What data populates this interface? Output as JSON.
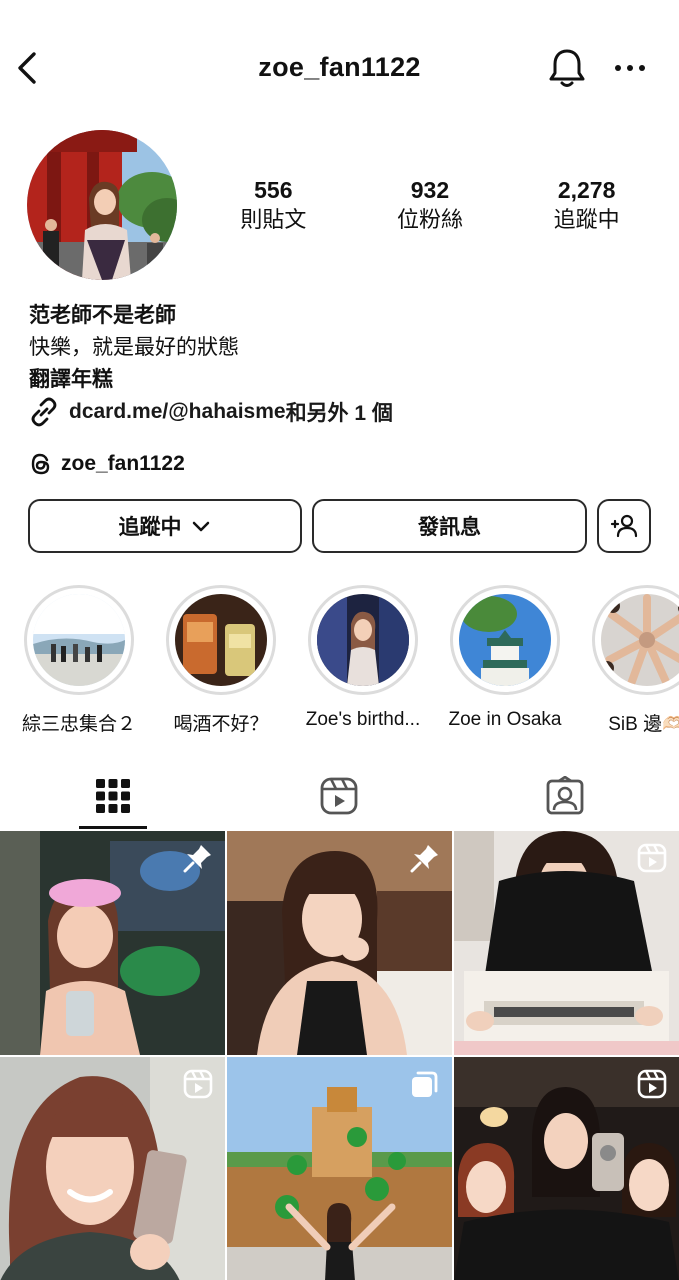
{
  "profile": {
    "username": "zoe_fan1122",
    "stats": [
      {
        "value": "556",
        "label": "則貼文"
      },
      {
        "value": "932",
        "label": "位粉絲"
      },
      {
        "value": "2,278",
        "label": "追蹤中"
      }
    ],
    "bio": {
      "name": "范老師不是老師",
      "line1": "快樂，就是最好的狀態",
      "line2": "翻譯年糕",
      "link_text": "dcard.me/@hahaisme",
      "link_suffix": "和另外 1 個",
      "threads_handle": "zoe_fan1122"
    }
  },
  "actions": {
    "follow_label": "追蹤中",
    "message_label": "發訊息"
  },
  "highlights": [
    {
      "label": "綜三忠集合２"
    },
    {
      "label": "喝酒不好？"
    },
    {
      "label": "Zoe's birthd..."
    },
    {
      "label": "Zoe in Osaka"
    },
    {
      "label": "SiB 邊🫶🏻"
    }
  ],
  "tabs": [
    "posts-grid",
    "reels",
    "tagged"
  ],
  "grid": [
    {
      "badge": "pin-icon"
    },
    {
      "badge": "pin-icon"
    },
    {
      "badge": "reel-icon"
    },
    {
      "badge": "reel-icon"
    },
    {
      "badge": "carousel-icon"
    },
    {
      "badge": "reel-icon"
    }
  ],
  "colors": {
    "text": "#111111",
    "border": "#2a2a2a",
    "highlight_ring": "#dcdcdc",
    "background": "#ffffff"
  }
}
